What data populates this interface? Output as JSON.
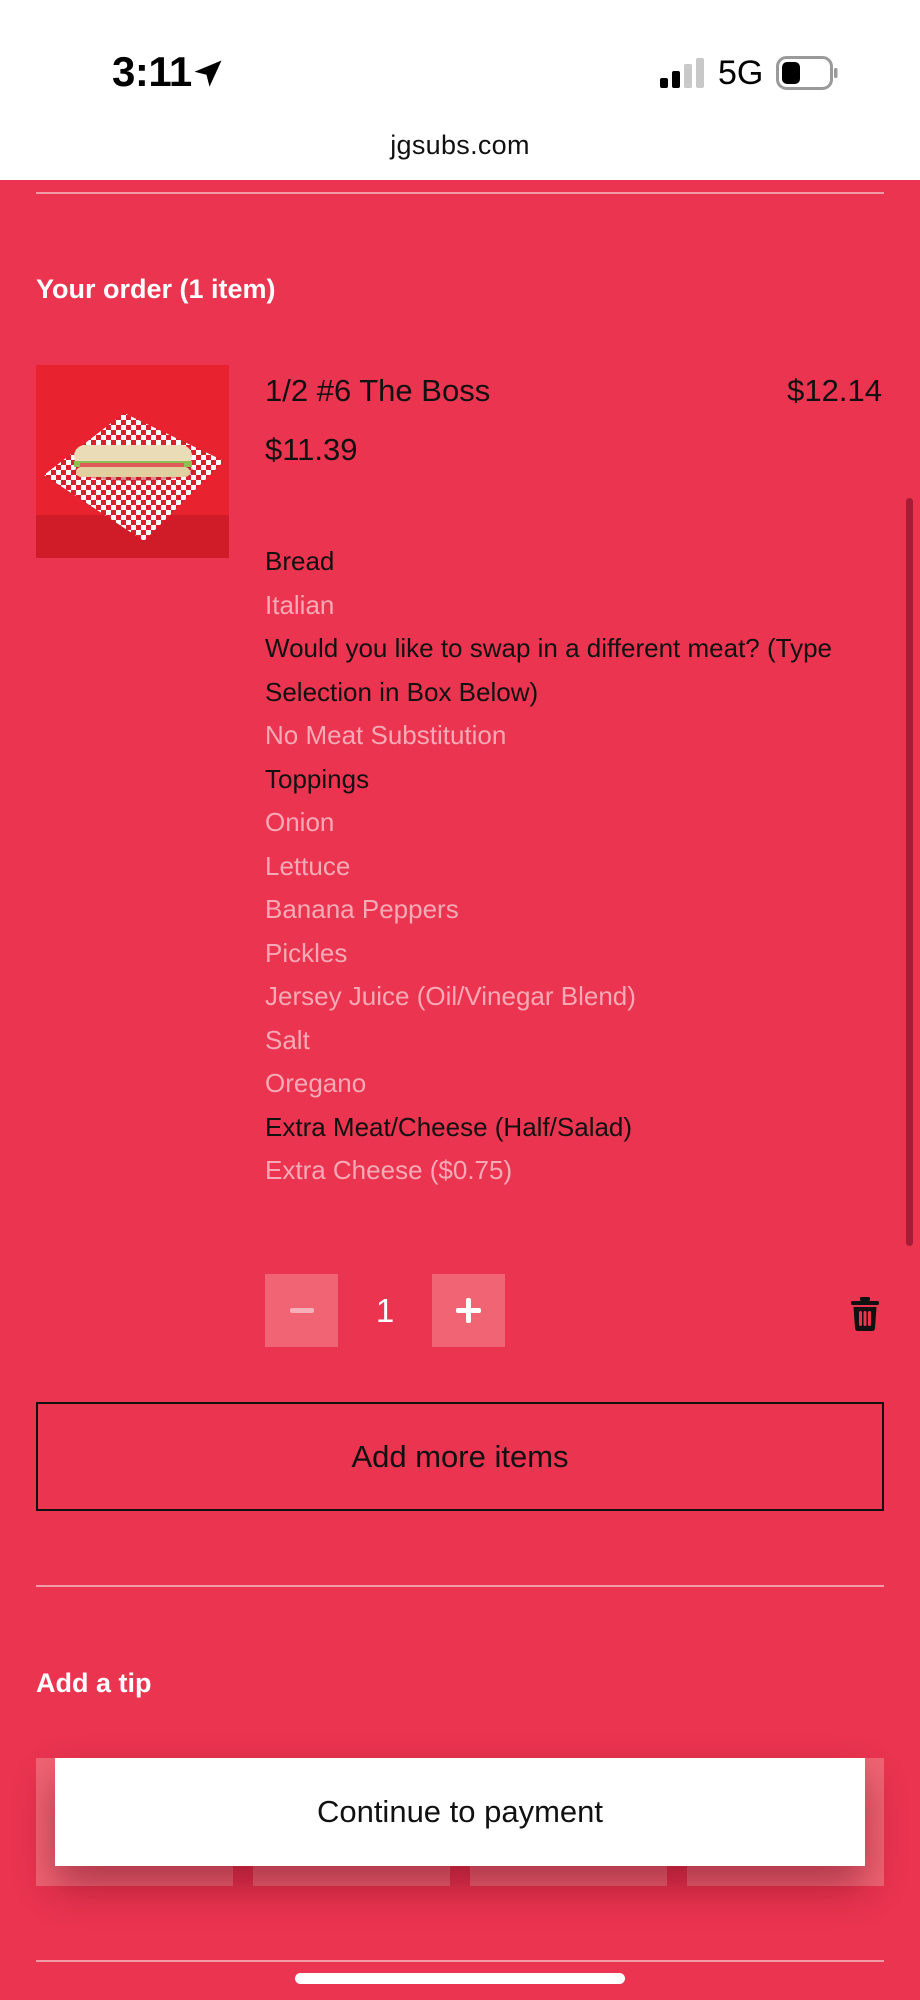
{
  "status_bar": {
    "time": "3:11",
    "network": "5G",
    "url": "jgsubs.com"
  },
  "order": {
    "title": "Your order (1 item)",
    "item": {
      "name": "1/2 #6 The Boss",
      "total": "$12.14",
      "base_price": "$11.39",
      "quantity": "1",
      "options": [
        {
          "kind": "heading",
          "text": "Bread"
        },
        {
          "kind": "value",
          "text": "Italian"
        },
        {
          "kind": "heading",
          "text": "Would you like to swap in a different meat? (Type Selection in Box Below)"
        },
        {
          "kind": "value",
          "text": "No Meat Substitution"
        },
        {
          "kind": "heading",
          "text": "Toppings"
        },
        {
          "kind": "value",
          "text": "Onion"
        },
        {
          "kind": "value",
          "text": "Lettuce"
        },
        {
          "kind": "value",
          "text": "Banana Peppers"
        },
        {
          "kind": "value",
          "text": "Pickles"
        },
        {
          "kind": "value",
          "text": "Jersey Juice (Oil/Vinegar Blend)"
        },
        {
          "kind": "value",
          "text": "Salt"
        },
        {
          "kind": "value",
          "text": "Oregano"
        },
        {
          "kind": "heading",
          "text": "Extra Meat/Cheese (Half/Salad)"
        },
        {
          "kind": "value",
          "text": "Extra Cheese ($0.75)"
        }
      ]
    },
    "add_more_label": "Add more items"
  },
  "tip": {
    "title": "Add a tip"
  },
  "continue_label": "Continue to payment",
  "colors": {
    "background": "#ea3450",
    "accent_button": "#f16474",
    "option_value": "#f7aab5"
  },
  "icons": {
    "location": "location-arrow-icon",
    "signal": "signal-icon",
    "battery": "battery-icon",
    "trash": "trash-icon",
    "minus": "minus-icon",
    "plus": "plus-icon"
  }
}
